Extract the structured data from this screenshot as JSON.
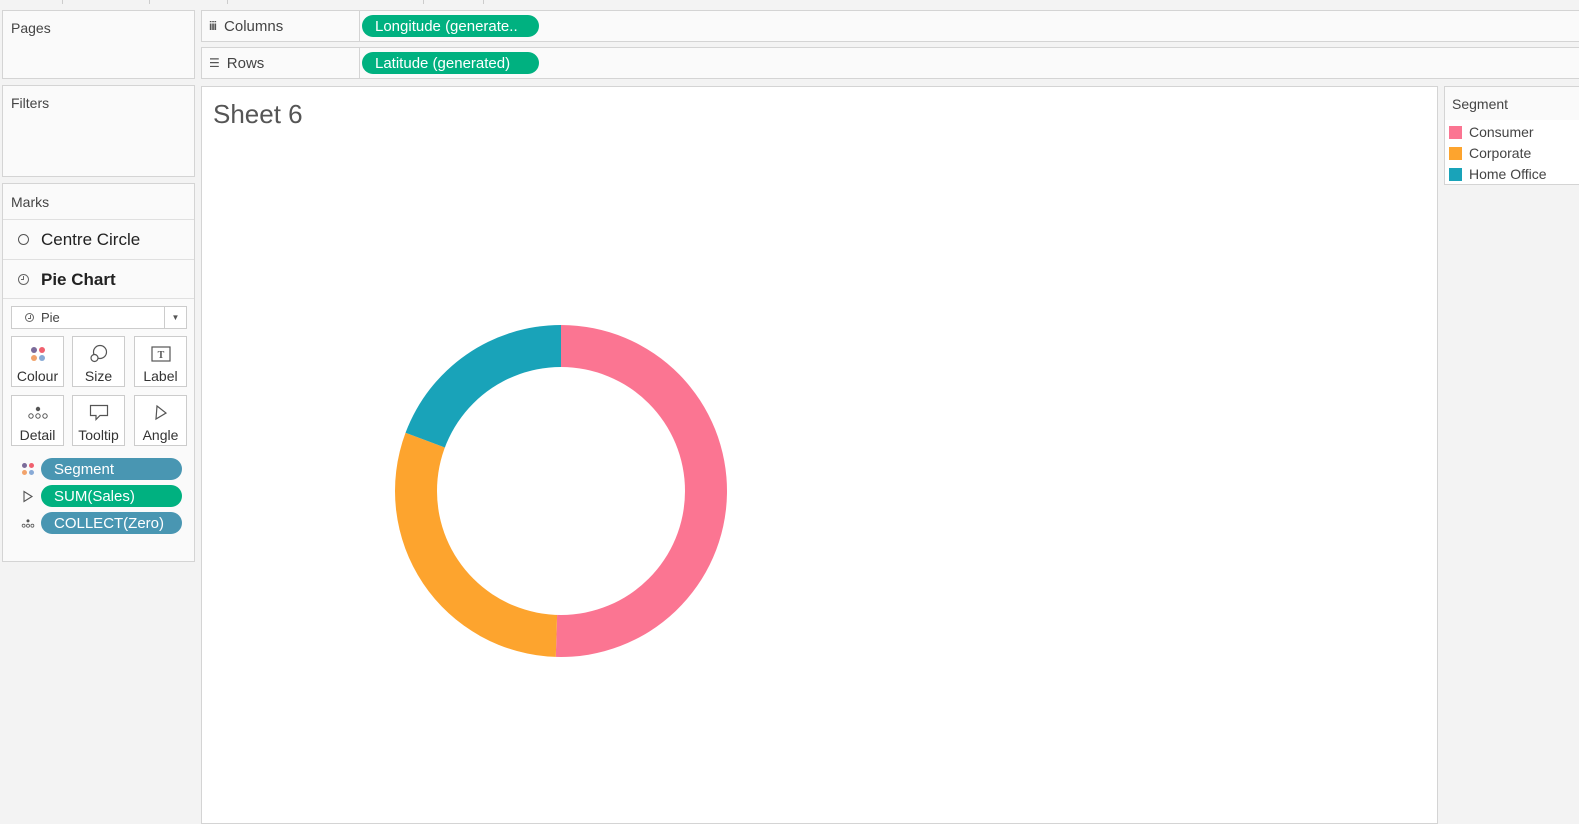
{
  "side_panels": {
    "pages_title": "Pages",
    "filters_title": "Filters",
    "marks_title": "Marks"
  },
  "shelves": {
    "columns": {
      "label": "Columns",
      "icon": "columns-icon",
      "pill": "Longitude (generate.."
    },
    "rows": {
      "label": "Rows",
      "icon": "rows-icon",
      "pill": "Latitude (generated)"
    }
  },
  "marks": {
    "layers": [
      {
        "label": "Centre Circle",
        "icon": "circle-icon",
        "selected": false
      },
      {
        "label": "Pie Chart",
        "icon": "pie-icon",
        "selected": true
      }
    ],
    "mark_type": "Pie",
    "cards": [
      {
        "label": "Colour",
        "icon": "colour-icon"
      },
      {
        "label": "Size",
        "icon": "size-icon"
      },
      {
        "label": "Label",
        "icon": "label-icon"
      },
      {
        "label": "Detail",
        "icon": "detail-icon"
      },
      {
        "label": "Tooltip",
        "icon": "tooltip-icon"
      },
      {
        "label": "Angle",
        "icon": "angle-icon"
      }
    ],
    "fields": [
      {
        "label": "Segment",
        "encoding": "colour",
        "type": "dimension"
      },
      {
        "label": "SUM(Sales)",
        "encoding": "angle",
        "type": "measure"
      },
      {
        "label": "COLLECT(Zero)",
        "encoding": "detail",
        "type": "dimension"
      }
    ]
  },
  "view": {
    "sheet_title": "Sheet 6"
  },
  "legend": {
    "title": "Segment",
    "items": [
      {
        "label": "Consumer",
        "color": "#fb7592"
      },
      {
        "label": "Corporate",
        "color": "#fda42e"
      },
      {
        "label": "Home Office",
        "color": "#19a3b9"
      }
    ]
  },
  "colors": {
    "measure_pill": "#00b180",
    "dimension_pill": "#4996b2"
  },
  "chart_data": {
    "type": "pie",
    "variant": "donut",
    "title": "Sheet 6",
    "legend_title": "Segment",
    "legend_position": "right",
    "categories": [
      "Consumer",
      "Corporate",
      "Home Office"
    ],
    "values": [
      50.5,
      30.2,
      19.3
    ],
    "value_unit": "approx. share of SUM(Sales), %",
    "colors": [
      "#fb7592",
      "#fda42e",
      "#19a3b9"
    ],
    "start_angle": "top, clockwise"
  }
}
